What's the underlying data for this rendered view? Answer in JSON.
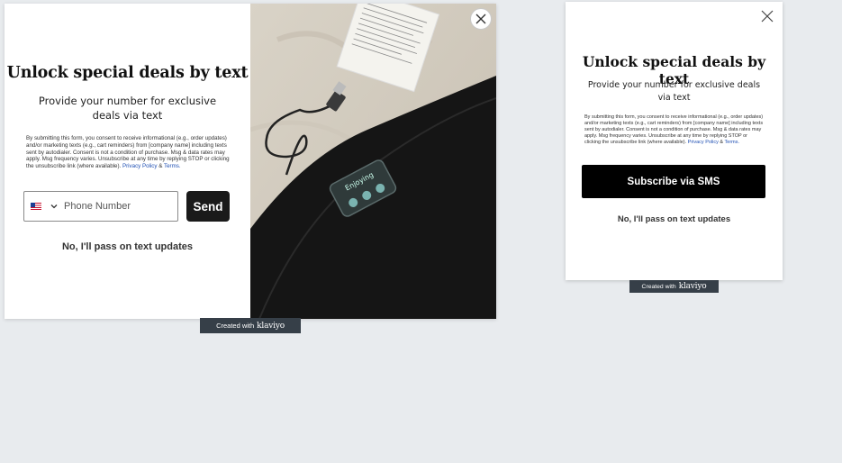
{
  "desktop_popup": {
    "title": "Unlock special deals by text",
    "subtitle": "Provide your number for exclusive deals via text",
    "legal_text": "By submitting this form, you consent to receive informational (e.g., order updates) and/or marketing texts (e.g., cart reminders) from [company name] including texts sent by autodialer. Consent is not a condition of purchase. Msg & data rates may apply. Msg frequency varies. Unsubscribe at any time by replying STOP or clicking the unsubscribe link (where available).",
    "privacy_link": "Privacy Policy",
    "ampersand": "&",
    "terms_link": "Terms.",
    "phone_placeholder": "Phone Number",
    "country_flag_icon": "us-flag-icon",
    "send_label": "Send",
    "decline_label": "No, I'll pass on text updates",
    "product_image_text": "Enjoying"
  },
  "mobile_popup": {
    "title": "Unlock special deals by text",
    "subtitle": "Provide your number for exclusive deals via text",
    "legal_text": "By submitting this form, you consent to receive informational (e.g., order updates) and/or marketing texts (e.g., cart reminders) from [company name] including texts sent by autodialer. Consent is not a condition of purchase. Msg & data rates may apply. Msg frequency varies. Unsubscribe at any time by replying STOP or clicking the unsubscribe link (where available).",
    "privacy_link": "Privacy Policy",
    "ampersand": "&",
    "terms_link": "Terms.",
    "subscribe_label": "Subscribe via SMS",
    "decline_label": "No, I'll pass on text updates"
  },
  "badge": {
    "created_with": "Created with",
    "brand": "klaviyo"
  },
  "colors": {
    "background": "#e8ebee",
    "button_dark": "#1a1a1a",
    "link_blue": "#1f4fb3",
    "badge_bg": "#363f48"
  }
}
